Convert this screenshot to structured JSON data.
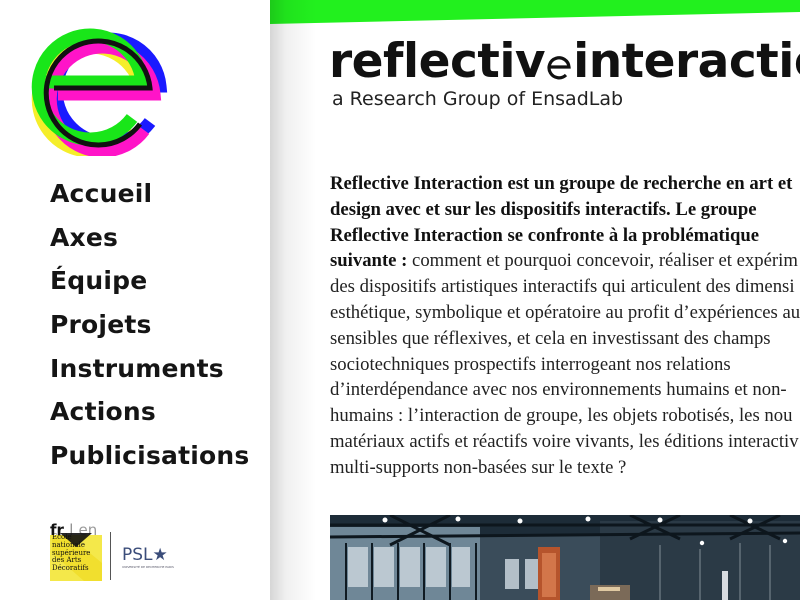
{
  "sidebar": {
    "logo_name": "ensadlab-e-logo",
    "nav": [
      {
        "label": "Accueil"
      },
      {
        "label": "Axes"
      },
      {
        "label": "Équipe"
      },
      {
        "label": "Projets"
      },
      {
        "label": "Instruments"
      },
      {
        "label": "Actions"
      },
      {
        "label": "Publicisations"
      }
    ],
    "language": {
      "active": "fr",
      "separator": " | ",
      "other": "en"
    },
    "partner_logos": {
      "ensad": "École\nnationale\nsupérieure\ndes Arts\nDécoratifs",
      "psl": "PSL★",
      "psl_sub": "UNIVERSITÉ DE RECHERCHE PARIS"
    }
  },
  "header": {
    "title_part1": "reflectiv",
    "title_part2": "interactio",
    "subtitle": "a Research Group of EnsadLab"
  },
  "intro": {
    "strong": "Reflective Interaction est un groupe de recherche en art et design avec et sur les dispositifs interactifs. Le groupe Reflective Interaction se confronte à la problématique suivante :",
    "body": " comment et pourquoi concevoir, réaliser et expérim des dispositifs artistiques interactifs qui articulent des dimensi esthétique, symbolique et opératoire au profit d’expériences au sensibles que réflexives, et cela en investissant des champs sociotechniques prospectifs interrogeant nos relations d’interdépendance avec nos environnements humains et non-humains : l’interaction de groupe, les objets robotisés, les nou matériaux actifs et réactifs voire vivants, les éditions interactiv multi-supports non-basées sur le texte ?"
  },
  "colors": {
    "accent_green": "#22f01e",
    "logo_green": "#19e619",
    "logo_blue": "#1a1aff",
    "logo_magenta": "#ff14c8",
    "logo_yellow": "#f5ee2a",
    "ensad_yellow": "#f4e84a",
    "text_dark": "#151515",
    "psl_blue": "#3b4d7a"
  }
}
